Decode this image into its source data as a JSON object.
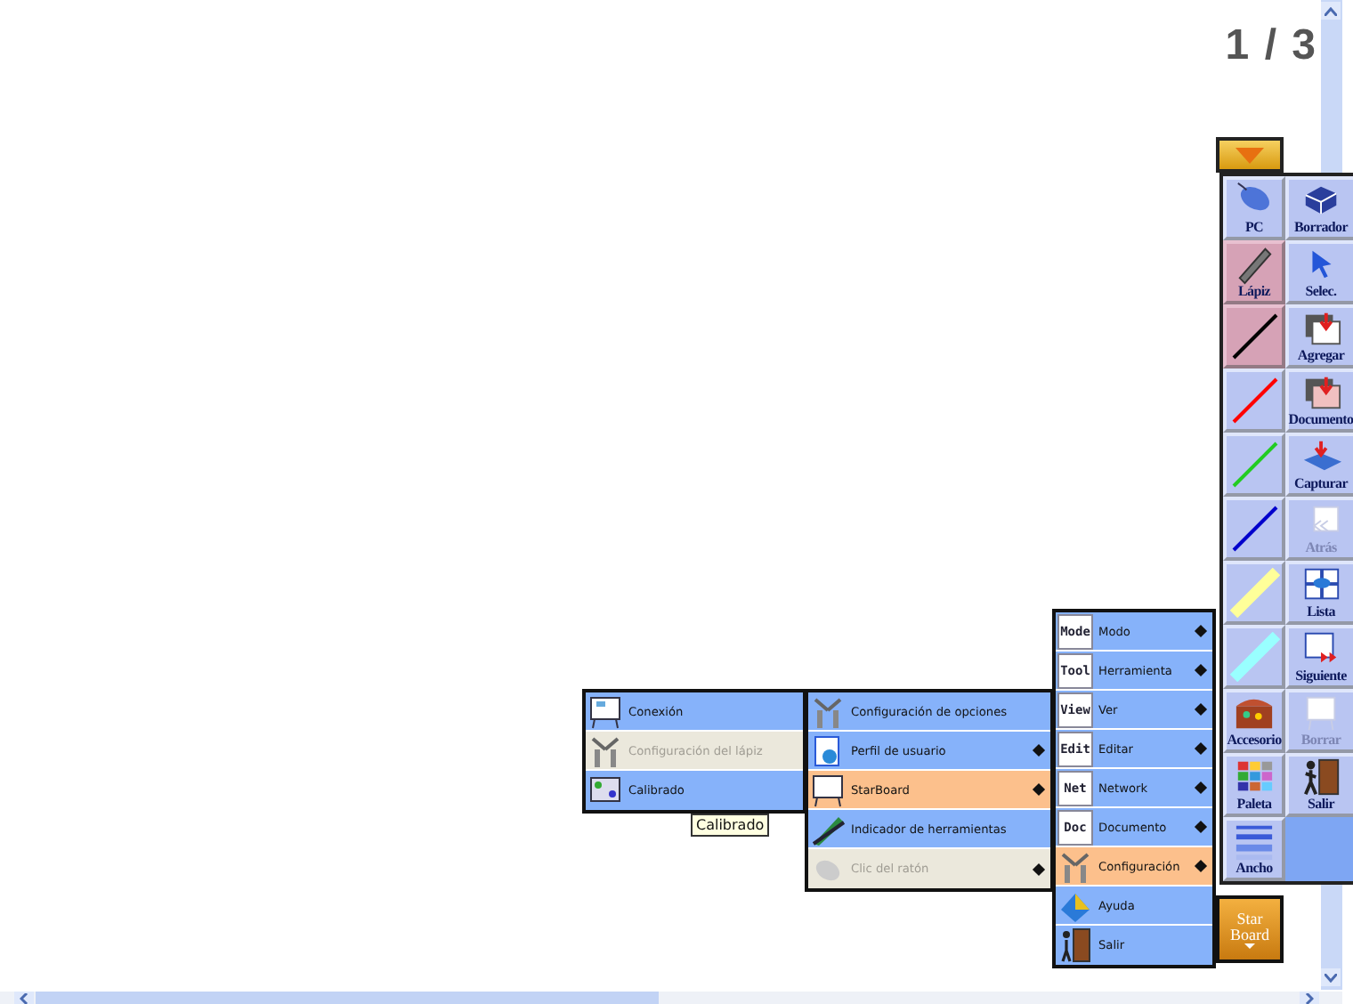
{
  "page_indicator": "1 / 3",
  "toolbar": {
    "items": [
      {
        "kind": "tool",
        "label": "PC",
        "selected": false,
        "disabled": false
      },
      {
        "kind": "tool",
        "label": "Borrador",
        "selected": false,
        "disabled": false
      },
      {
        "kind": "tool",
        "label": "Lápiz",
        "selected": true,
        "disabled": false
      },
      {
        "kind": "tool",
        "label": "Selec.",
        "selected": false,
        "disabled": false
      },
      {
        "kind": "pen",
        "color": "#000000",
        "selected": true
      },
      {
        "kind": "tool",
        "label": "Agregar",
        "selected": false,
        "disabled": false
      },
      {
        "kind": "pen",
        "color": "#ff0000",
        "selected": false
      },
      {
        "kind": "tool",
        "label": "Documento",
        "selected": false,
        "disabled": false
      },
      {
        "kind": "pen",
        "color": "#22cc22",
        "selected": false
      },
      {
        "kind": "tool",
        "label": "Capturar",
        "selected": false,
        "disabled": false
      },
      {
        "kind": "pen",
        "color": "#0000cc",
        "selected": false
      },
      {
        "kind": "tool",
        "label": "Atrás",
        "selected": false,
        "disabled": true
      },
      {
        "kind": "highlighter",
        "color": "#ffff99",
        "selected": false
      },
      {
        "kind": "tool",
        "label": "Lista",
        "selected": false,
        "disabled": false
      },
      {
        "kind": "highlighter",
        "color": "#99ffff",
        "selected": false
      },
      {
        "kind": "tool",
        "label": "Siguiente",
        "selected": false,
        "disabled": false
      },
      {
        "kind": "tool",
        "label": "Accesorio",
        "selected": false,
        "disabled": false
      },
      {
        "kind": "tool",
        "label": "Borrar",
        "selected": false,
        "disabled": true
      },
      {
        "kind": "tool",
        "label": "Paleta",
        "selected": false,
        "disabled": false
      },
      {
        "kind": "tool",
        "label": "Salir",
        "selected": false,
        "disabled": false
      },
      {
        "kind": "tool",
        "label": "Ancho",
        "selected": false,
        "disabled": false
      }
    ]
  },
  "starboard_button": {
    "label": "Star Board"
  },
  "menu": {
    "items": [
      {
        "icon_text": "Mode",
        "label": "Modo",
        "submenu": true,
        "selected": false,
        "disabled": false
      },
      {
        "icon_text": "Tool",
        "label": "Herramienta",
        "submenu": true,
        "selected": false,
        "disabled": false
      },
      {
        "icon_text": "View",
        "label": "Ver",
        "submenu": true,
        "selected": false,
        "disabled": false
      },
      {
        "icon_text": "Edit",
        "label": "Editar",
        "submenu": true,
        "selected": false,
        "disabled": false
      },
      {
        "icon_text": "Net",
        "label": "Network",
        "submenu": true,
        "selected": false,
        "disabled": false
      },
      {
        "icon_text": "Doc",
        "label": "Documento",
        "submenu": true,
        "selected": false,
        "disabled": false
      },
      {
        "label": "Configuración",
        "submenu": true,
        "selected": true,
        "disabled": false
      },
      {
        "label": "Ayuda",
        "submenu": false,
        "selected": false,
        "disabled": false
      },
      {
        "label": "Salir",
        "submenu": false,
        "selected": false,
        "disabled": false
      }
    ]
  },
  "submenu": {
    "items": [
      {
        "label": "Configuración de opciones",
        "submenu": false,
        "selected": false,
        "disabled": false
      },
      {
        "label": "Perfil de usuario",
        "submenu": true,
        "selected": false,
        "disabled": false
      },
      {
        "label": "StarBoard",
        "submenu": true,
        "selected": true,
        "disabled": false
      },
      {
        "label": "Indicador de herramientas",
        "submenu": false,
        "selected": false,
        "disabled": false
      },
      {
        "label": "Clic del ratón",
        "submenu": true,
        "selected": false,
        "disabled": true
      }
    ]
  },
  "submenu_2": {
    "items": [
      {
        "label": "Conexión",
        "submenu": false,
        "selected": false,
        "disabled": false
      },
      {
        "label": "Configuración del lápiz",
        "submenu": false,
        "selected": false,
        "disabled": true
      },
      {
        "label": "Calibrado",
        "submenu": false,
        "selected": false,
        "disabled": false
      }
    ]
  },
  "tooltip": "Calibrado"
}
